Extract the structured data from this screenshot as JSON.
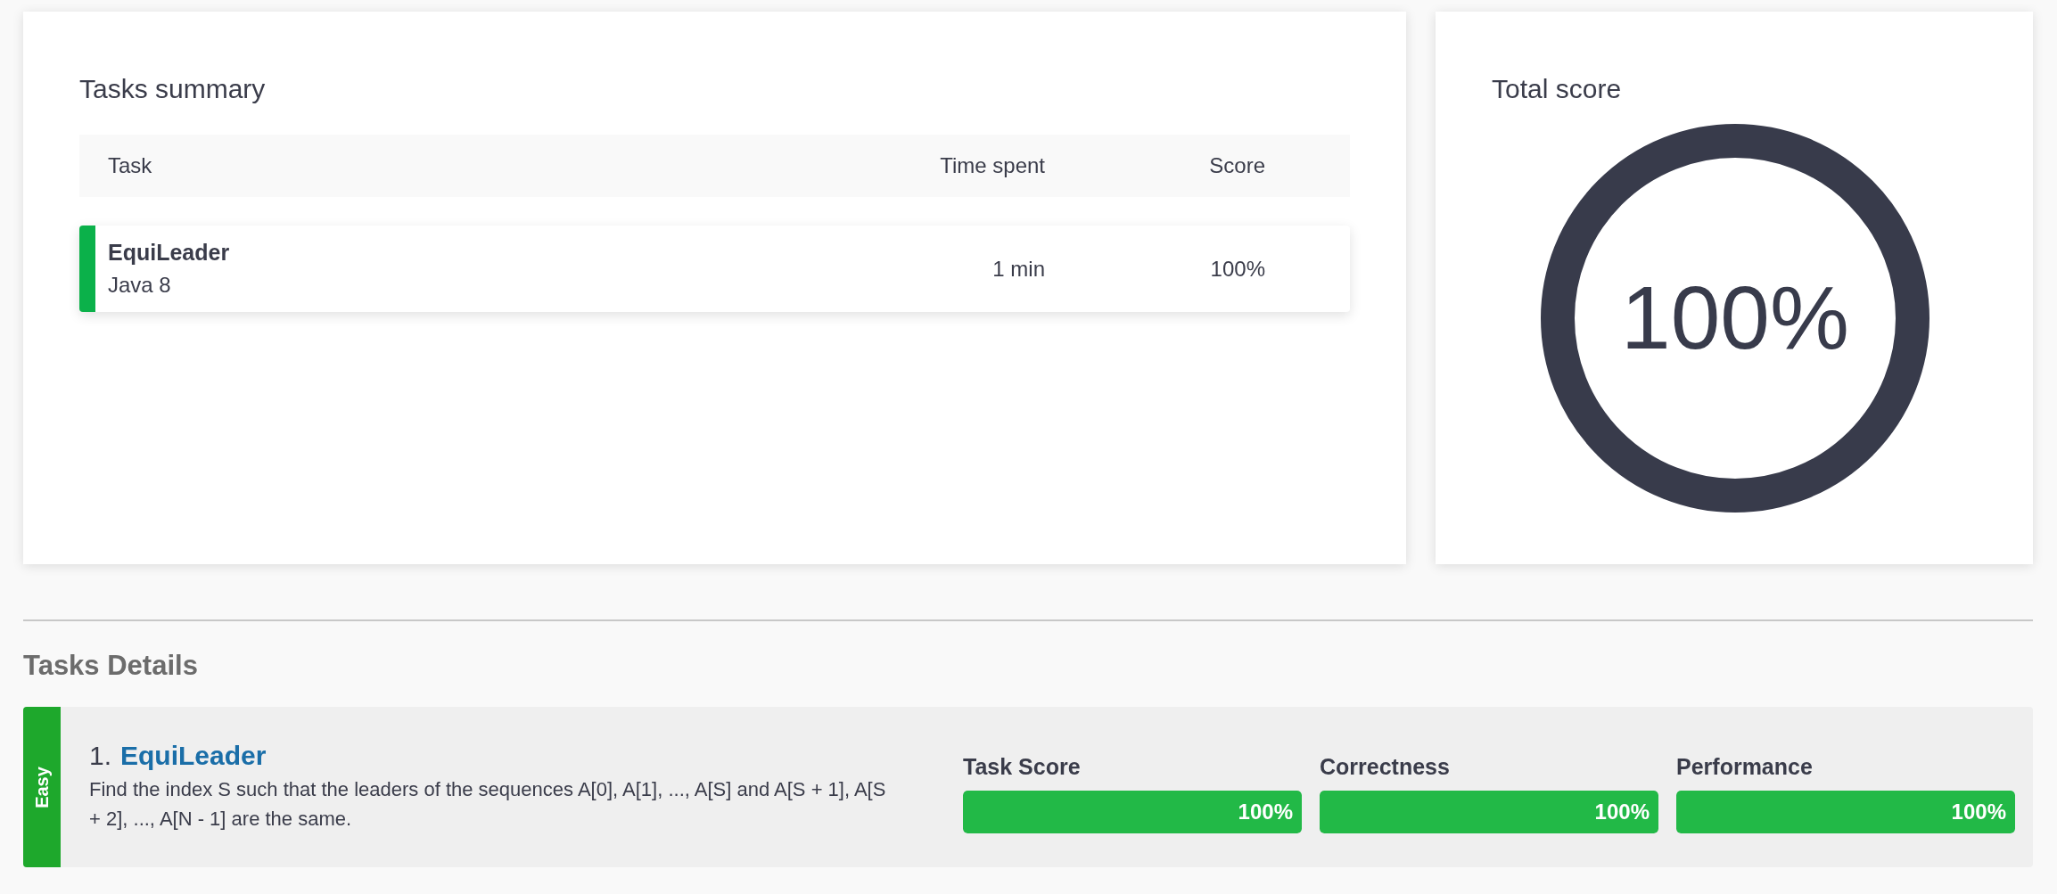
{
  "summary": {
    "title": "Tasks summary",
    "columns": [
      "Task",
      "Time spent",
      "Score"
    ],
    "rows": [
      {
        "task": "EquiLeader",
        "language": "Java 8",
        "time": "1 min",
        "score": "100%",
        "color": "#0bb14a"
      }
    ]
  },
  "total_score": {
    "title": "Total score",
    "value": "100%",
    "level": 1
  },
  "details": {
    "title": "Tasks Details",
    "tasks": [
      {
        "difficulty": "Easy",
        "number": "1.",
        "name": "EquiLeader",
        "description": "Find the index S such that the leaders of the sequences A[0], A[1], ..., A[S] and A[S + 1], A[S + 2], ..., A[N - 1] are the same.",
        "metrics": [
          {
            "label": "Task Score",
            "value": "100%",
            "level": 1
          },
          {
            "label": "Correctness",
            "value": "100%",
            "level": 1
          },
          {
            "label": "Performance",
            "value": "100%",
            "level": 1
          }
        ]
      }
    ]
  }
}
